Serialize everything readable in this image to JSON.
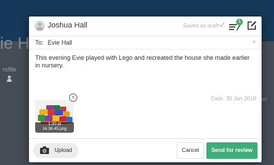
{
  "colors": {
    "accent": "#3cae77",
    "badge": "#4caf6a",
    "muted_text": "#b3b3b3",
    "backdrop_top": "#16385a",
    "backdrop": "#464c55"
  },
  "background": {
    "name_fragment": "ie H",
    "profile_label": "rofile",
    "person_icon": "person-icon",
    "right_fragment": "ser"
  },
  "header": {
    "author": "Joshua Hall",
    "avatar_icon": "avatar",
    "saved_status": "Saved as draft",
    "saved_icon": "check-icon",
    "list_icon": "list-icon",
    "badge_count": "1",
    "edit_icon": "edit-icon"
  },
  "recipient": {
    "label": "To:",
    "value": "Evie Hall",
    "remove": "×"
  },
  "note": {
    "text": "This evening Evie played with Lego and recreated the house she made earlier in nursery."
  },
  "attachment": {
    "date": "Date: 30 Jan 2018",
    "caption_line1": "1-30 at",
    "caption_line2": "14.36.45.png",
    "remove": "×"
  },
  "footer": {
    "upload_label": "Upload",
    "upload_icon": "camera-icon",
    "cancel_label": "Cancel",
    "send_label": "Send for review"
  }
}
